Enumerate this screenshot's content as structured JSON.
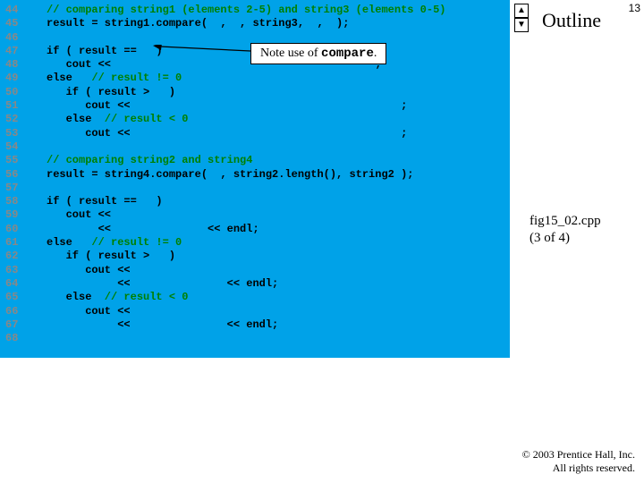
{
  "slide_number": "13",
  "outline_label": "Outline",
  "nav": {
    "up": "▲",
    "down": "▼"
  },
  "caption": {
    "file": "fig15_02.cpp",
    "part": "(3 of 4)"
  },
  "annotation": {
    "prefix": "Note use of ",
    "kw": "compare",
    "suffix": "."
  },
  "copyright": {
    "line1": "© 2003 Prentice Hall, Inc.",
    "line2": "All rights reserved."
  },
  "lines": [
    {
      "n": "44",
      "c": "// comparing string1 (elements 2-5) and string3 (elements 0-5)",
      "cm": true
    },
    {
      "n": "45",
      "c": "result = string1.compare(  ,  , string3,  ,  );"
    },
    {
      "n": "46",
      "c": ""
    },
    {
      "n": "47",
      "c": "if ( result ==   )"
    },
    {
      "n": "48",
      "c": "   cout <<                                         ;"
    },
    {
      "n": "49",
      "c": "else   // result != 0",
      "tail_cm": 7
    },
    {
      "n": "50",
      "c": "   if ( result >   )"
    },
    {
      "n": "51",
      "c": "      cout <<                                          ;"
    },
    {
      "n": "52",
      "c": "   else  // result < 0",
      "tail_cm": 8
    },
    {
      "n": "53",
      "c": "      cout <<                                          ;"
    },
    {
      "n": "54",
      "c": ""
    },
    {
      "n": "55",
      "c": "// comparing string2 and string4",
      "cm": true
    },
    {
      "n": "56",
      "c": "result = string4.compare(  , string2.length(), string2 );"
    },
    {
      "n": "57",
      "c": ""
    },
    {
      "n": "58",
      "c": "if ( result ==   )"
    },
    {
      "n": "59",
      "c": "   cout <<"
    },
    {
      "n": "60",
      "c": "        <<               << endl;"
    },
    {
      "n": "61",
      "c": "else   // result != 0",
      "tail_cm": 7
    },
    {
      "n": "62",
      "c": "   if ( result >   )"
    },
    {
      "n": "63",
      "c": "      cout <<"
    },
    {
      "n": "64",
      "c": "           <<               << endl;"
    },
    {
      "n": "65",
      "c": "   else  // result < 0",
      "tail_cm": 8
    },
    {
      "n": "66",
      "c": "      cout <<"
    },
    {
      "n": "67",
      "c": "           <<               << endl;"
    },
    {
      "n": "68",
      "c": ""
    }
  ]
}
